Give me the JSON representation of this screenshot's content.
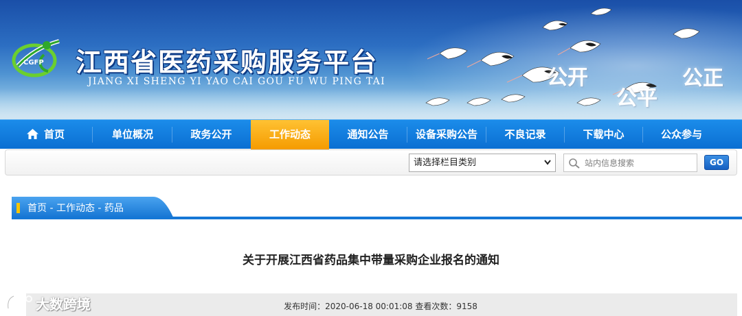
{
  "header": {
    "site_title": "江西省医药采购服务平台",
    "site_pinyin": "JIANG XI SHENG YI YAO CAI GOU FU WU PING TAI",
    "logo_text": "CGFP",
    "slogans": [
      "公开",
      "公平",
      "公正"
    ]
  },
  "nav": {
    "items": [
      {
        "label": "首页",
        "icon": "home-icon"
      },
      {
        "label": "单位概况"
      },
      {
        "label": "政务公开"
      },
      {
        "label": "工作动态",
        "active": true
      },
      {
        "label": "通知公告"
      },
      {
        "label": "设备采购公告"
      },
      {
        "label": "不良记录"
      },
      {
        "label": "下载中心"
      },
      {
        "label": "公众参与"
      }
    ]
  },
  "search": {
    "category_value": "请选择栏目类别",
    "placeholder": "站内信息搜索",
    "go_label": "GO"
  },
  "breadcrumb": {
    "home": "首页",
    "sep": " - ",
    "section": "工作动态",
    "sub": "药品"
  },
  "article": {
    "title": "关于开展江西省药品集中带量采购企业报名的通知",
    "meta": "发布时间：2020-06-18 00:01:08 查看次数：9158"
  },
  "watermark": {
    "text": "大数跨境"
  },
  "colors": {
    "nav_blue": "#0b6fd2",
    "nav_active": "#f59b00",
    "breadcrumb_blue": "#1577d6",
    "go_button": "#1660c2"
  }
}
